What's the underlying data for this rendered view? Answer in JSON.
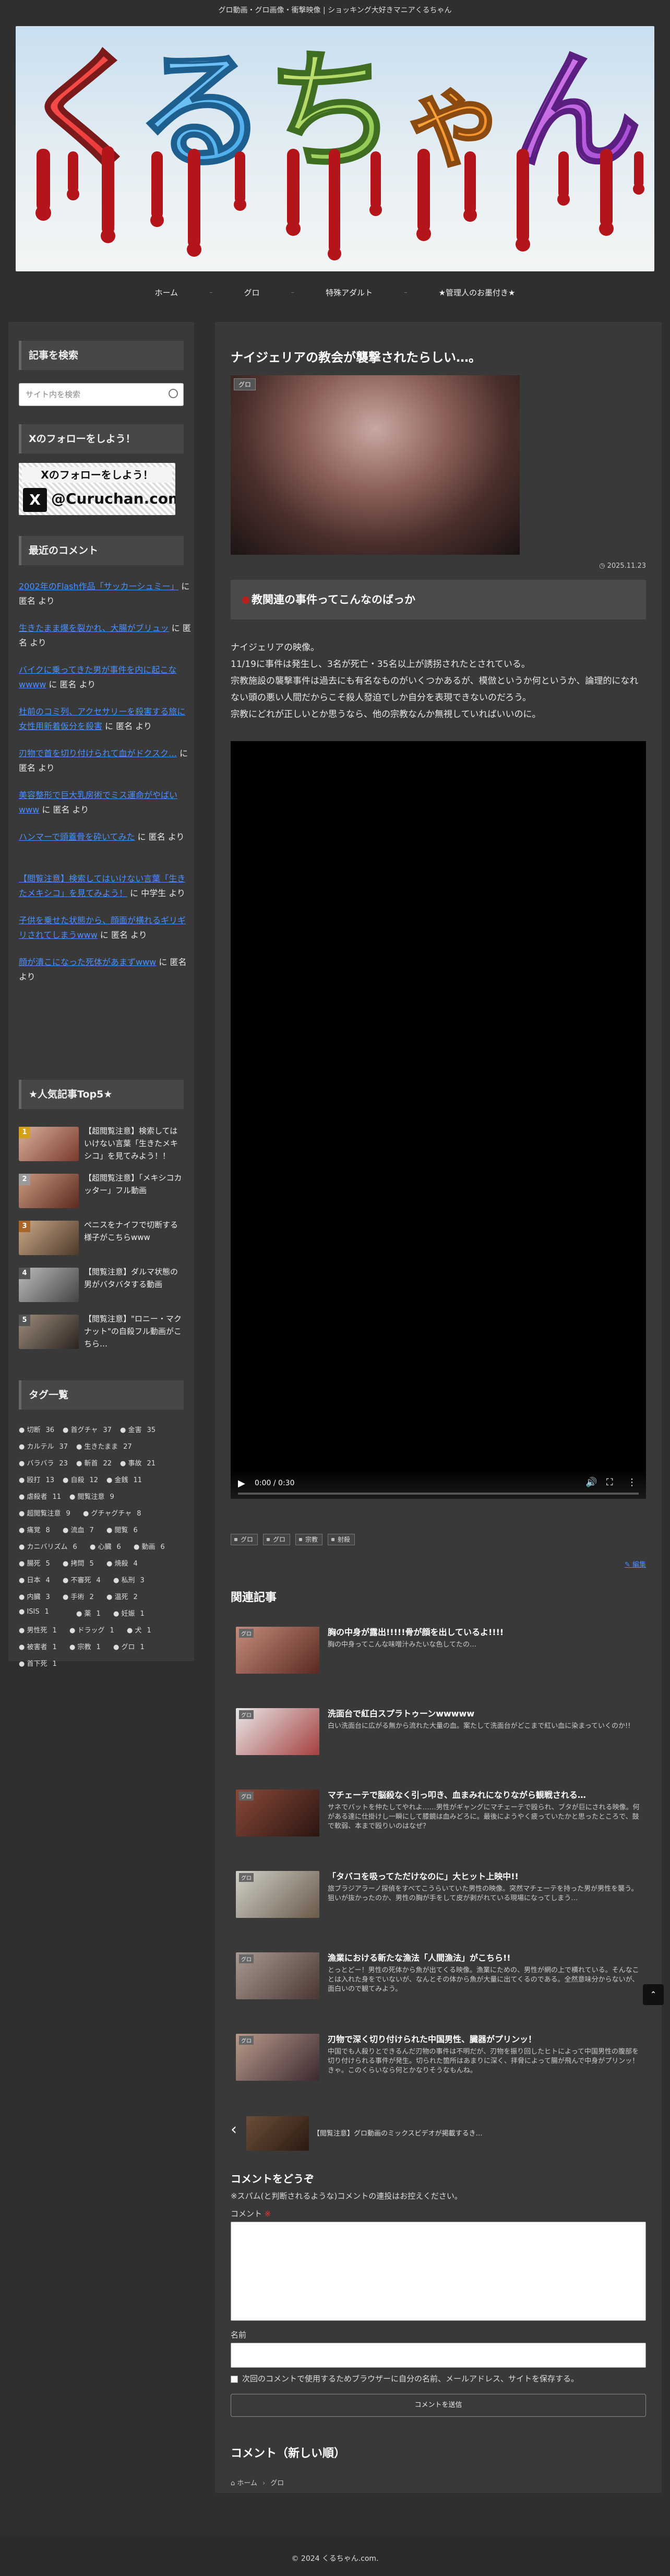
{
  "site": {
    "tagline": "グロ動画・グロ画像・衝撃映像 | ショッキング大好きマニアくるちゃん",
    "logo_text": "くるちゃん",
    "footer": "© 2024 くるちゃん.com."
  },
  "nav": {
    "items": [
      "ホーム",
      "グロ",
      "特殊アダルト",
      "★管理人のお墨付き★"
    ]
  },
  "sidebar": {
    "search_title": "記事を検索",
    "search_placeholder": "サイト内を検索",
    "follow_title": "Xのフォローをしよう！",
    "follow_banner_title": "Xのフォローをしよう！",
    "follow_handle": "@Curuchan.com",
    "recent_comments_title": "最近のコメント",
    "recent_comments": [
      {
        "link": "2002年のFlash作品「サッカーシュミー」",
        "suffix": " に 匿名 より"
      },
      {
        "link": "生きたまま爆を裂かれ、大腸がブリュッ",
        "suffix": " に 匿名 より"
      },
      {
        "link": "バイクに乗ってきた男が事件を内に起こなwwww",
        "suffix": " に 匿名 より"
      },
      {
        "link": "杜前のコミ列、アクセサリーを殺害する旅に女性用新着仮分を殺害",
        "suffix": " に 匿名 より"
      },
      {
        "link": "刃物で首を切り付けられて血がドクスク…",
        "suffix": " に 匿名 より"
      },
      {
        "link": "美容整形で巨大乳房術でミス運命がやばいwww",
        "suffix": " に 匿名 より"
      },
      {
        "link": "ハンマーで頭蓋骨を砕いてみた",
        "suffix": " に 匿名 より"
      },
      {
        "link": "【閲覧注意】検索してはいけない言葉「生きたメキシコ」を見てみよう！",
        "suffix": " に 中学生 より"
      },
      {
        "link": "子供を乗せた状態から、顔面が横れるギリギリされてしまうwww",
        "suffix": " に 匿名 より"
      },
      {
        "link": "顔が潰こになった死体があまずwww",
        "suffix": " に 匿名 より"
      }
    ],
    "popular_title": "★人気記事Top5★",
    "popular": [
      {
        "num": "1",
        "title": "【超閲覧注意】検索してはいけない言葉「生きたメキシコ」を見てみよう！！"
      },
      {
        "num": "2",
        "title": "【超閲覧注意】「メキシコカッター」フル動画"
      },
      {
        "num": "3",
        "title": "ペニスをナイフで切断する様子がこちらwww"
      },
      {
        "num": "4",
        "title": "【閲覧注意】ダルマ状態の男がバタバタする動画"
      },
      {
        "num": "5",
        "title": "【閲覧注意】\"ロニー・マクナット\"の自殺フル動画がこちら…"
      }
    ],
    "tags_title": "タグ一覧",
    "tags": [
      [
        "切断",
        "36"
      ],
      [
        "首グチャ",
        "37"
      ],
      [
        "金害",
        "35"
      ],
      [
        "カルテル",
        "37"
      ],
      [
        "生きたまま",
        "27"
      ],
      [
        "バラバラ",
        "23"
      ],
      [
        "斬首",
        "22"
      ],
      [
        "事故",
        "21"
      ],
      [
        "殴打",
        "13"
      ],
      [
        "自殺",
        "12"
      ],
      [
        "金銭",
        "11"
      ],
      [
        "虐殺者",
        "11"
      ],
      [
        "閲覧注意",
        "9"
      ],
      [
        "超閲覧注意",
        "9"
      ],
      [
        "グチャグチャ",
        "8"
      ],
      [
        "痛覚",
        "8"
      ],
      [
        "流血",
        "7"
      ],
      [
        "閲覧",
        "6"
      ],
      [
        "カニバリズム",
        "6"
      ],
      [
        "心臓",
        "6"
      ],
      [
        "動画",
        "6"
      ],
      [
        "腸死",
        "5"
      ],
      [
        "拷問",
        "5"
      ],
      [
        "焼殺",
        "4"
      ],
      [
        "日本",
        "4"
      ],
      [
        "不審死",
        "4"
      ],
      [
        "私刑",
        "3"
      ],
      [
        "内臓",
        "3"
      ],
      [
        "手術",
        "2"
      ],
      [
        "温死",
        "2"
      ],
      [
        "ISIS",
        "1"
      ],
      [
        "薬",
        "1"
      ],
      [
        "妊娠",
        "1"
      ],
      [
        "男性死",
        "1"
      ],
      [
        "ドラッグ",
        "1"
      ],
      [
        "犬",
        "1"
      ],
      [
        "被害者",
        "1"
      ],
      [
        "宗教",
        "1"
      ],
      [
        "グロ",
        "1"
      ],
      [
        "首下死",
        "1"
      ]
    ]
  },
  "post": {
    "title": "ナイジェリアの教会が襲撃されたらしい…。",
    "category": "グロ",
    "date": "2025.11.23",
    "h2": "教関連の事件ってこんなのばっか",
    "body": [
      "ナイジェリアの映像。",
      "11/19に事件は発生し、3名が死亡・35名以上が誘拐されたとされている。",
      "宗教施設の襲撃事件は過去にも有名なものがいくつかあるが、模倣というか何というか、論理的になれない頭の悪い人間だからこそ殺人發迫でしか自分を表現できないのだろう。",
      "宗教にどれが正しいとか思うなら、他の宗教なんか無視していればいいのに。"
    ],
    "video_time": "0:00 / 0:30",
    "tags": [
      "グロ",
      "グロ",
      "宗教",
      "射殺"
    ],
    "edit_link": "編集",
    "related_title": "関連記事",
    "related": [
      {
        "badge": "グロ",
        "title": "胸の中身が露出!!!!!骨が顔を出しているよ!!!!",
        "desc": "胸の中身ってこんな味噌汁みたいな色してたの…"
      },
      {
        "badge": "グロ",
        "title": "洗面台で紅白スプラトゥーンwwwww",
        "desc": "白い洗面台に広がる無から流れた大量の血。案たして洗面台がどこまで紅い血に染まっていくのか!!"
      },
      {
        "badge": "グロ",
        "title": "マチェーテで脳殺なく引っ叩き、血まみれになりながら観戦される…",
        "desc": "サネでバットを仲たしてやれよ……男性がギャングにマチェーテで殴られ、ブタが巨にされる映像。何がある達に仕掛けし一瞬にして膝鏡は血みどろに。最後にようやく疲っていたかと思ったところで、鼓で軟弱、本まで殴りいのはなぜ？"
      },
      {
        "badge": "グロ",
        "title": "「タバコを吸ってただけなのに」大ヒット上映中!!",
        "desc": "旅ブラジアラーノ探偵をすべてこうらいていた男性の映像。突然マチェーテを持った男が男性を襲う。狙いが抜かったのか、男性の胸が手をして皮が剥がれている現場になってしまう…"
      },
      {
        "badge": "グロ",
        "title": "漁業における新たな漁法「人間漁法」がこちら!!",
        "desc": "とっとどー！男性の死体から魚が出てくる映像。漁業にための、男性が網の上で横れている。そんなことは入れた身をでいないが、なんとその体から魚が大量に出てくるのである。全然意味分からないが、面白いので観てみよう。"
      },
      {
        "badge": "グロ",
        "title": "刃物で深く切り付けられた中国男性、臓器がプリンッ！",
        "desc": "中国でも人殺りとできるんだ刃物の事件は不明だが、刃物を振り回したヒトによって中国男性の腹部を切り付けられる事件が発生。切られた箇所はあまりに深く、拝脅によって腸が飛んで中身がプリンッ！きゃ。このくらいなら何とかなりそうなもんね。"
      }
    ],
    "prev_title": "【閲覧注意】グロ動画のミックスビデオが掲載するき…",
    "comment_form_title": "コメントをどうぞ",
    "comment_note": "※スパム(と判断されるような)コメントの連投はお控えください。",
    "comment_label": "コメント",
    "required_mark": "※",
    "name_label": "名前",
    "save_label": "次回のコメントで使用するためブラウザーに自分の名前、メールアドレス、サイトを保存する。",
    "submit_label": "コメントを送信",
    "comments_title": "コメント（新しい順）",
    "breadcrumb": [
      "ホーム",
      "グロ"
    ]
  },
  "colors": {
    "background": "#2f2f2f",
    "panel": "#393939",
    "link": "#4a90ff",
    "accent_red": "#b82020"
  },
  "icons": [
    "search-icon",
    "x-logo-icon",
    "play-icon",
    "volume-icon",
    "fullscreen-icon",
    "more-icon",
    "tag-icon",
    "pencil-icon",
    "chevron-left-icon",
    "home-icon",
    "clock-icon",
    "arrow-up-icon"
  ]
}
